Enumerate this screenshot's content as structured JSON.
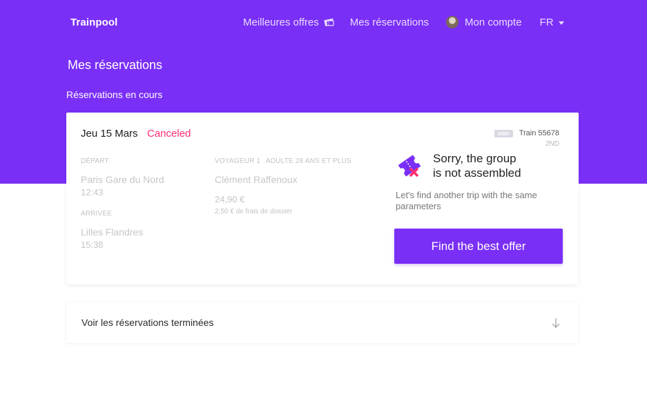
{
  "header": {
    "brand": "Trainpool",
    "nav": {
      "offers": "Meilleures offres",
      "reservations": "Mes réservations",
      "account": "Mon compte",
      "language": "FR"
    }
  },
  "page": {
    "title": "Mes réservations",
    "section_current": "Réservations en cours"
  },
  "booking": {
    "date": "Jeu 15 Mars",
    "status": "Canceled",
    "train": "Train 55678",
    "class": "2ND",
    "departure_label": "DÉPART",
    "departure_station": "Paris Gare du Nord",
    "departure_time": "12:43",
    "arrival_label": "ARRIVEE",
    "arrival_station": "Lilles Flandres",
    "arrival_time": "15:38",
    "traveler_label": "VOYAGEUR 1",
    "traveler_type": "ADULTE 28 ANS ET PLUS",
    "traveler_name": "Clément Raffenoux",
    "price": "24,90 €",
    "fees": "2,50 € de frais de dossier"
  },
  "notice": {
    "title_line1": "Sorry, the group",
    "title_line2": "is not assembled",
    "subtitle": "Let's find another trip with the same parameters",
    "cta": "Find the best offer"
  },
  "past": {
    "label": "Voir les réservations terminées"
  },
  "colors": {
    "brand": "#7a2ff7",
    "canceled": "#ff2d6f"
  }
}
